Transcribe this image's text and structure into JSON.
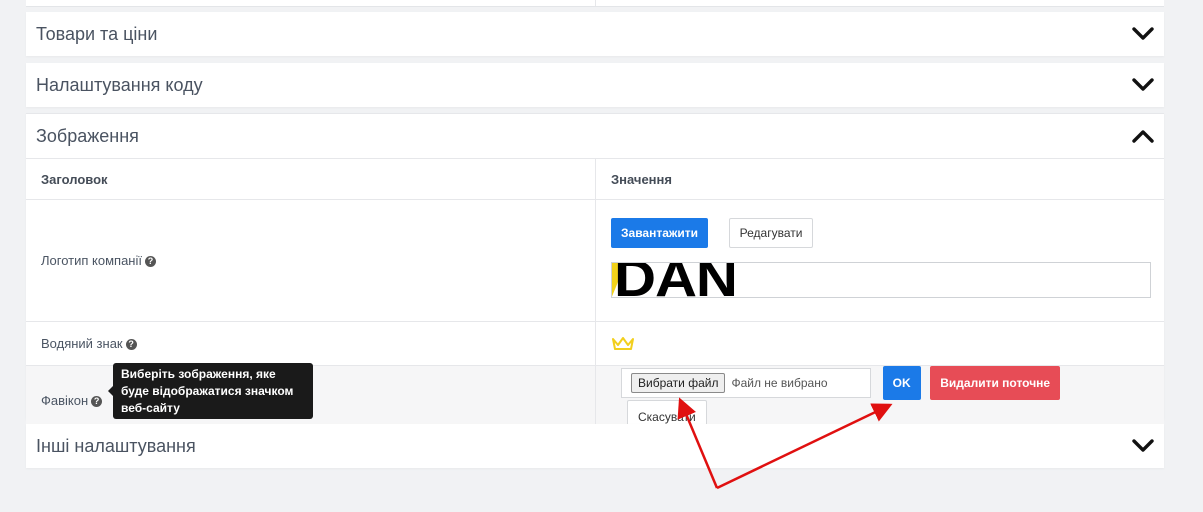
{
  "panels": {
    "goods": {
      "title": "Товари та ціни"
    },
    "code": {
      "title": "Налаштування коду"
    },
    "images": {
      "title": "Зображення"
    },
    "other": {
      "title": "Інші налаштування"
    }
  },
  "table": {
    "headers": {
      "title": "Заголовок",
      "value": "Значення"
    },
    "rows": {
      "logo": {
        "label": "Логотип компанії",
        "upload_label": "Завантажити",
        "edit_label": "Редагувати",
        "logo_text": "DAN"
      },
      "watermark": {
        "label": "Водяний знак"
      },
      "favicon": {
        "label": "Фавікон",
        "choose_file_label": "Вибрати файл",
        "file_status": "Файл не вибрано",
        "ok_label": "OK",
        "delete_label": "Видалити поточне",
        "cancel_label": "Скасувати"
      }
    }
  },
  "tooltip": {
    "text": "Виберіть зображення, яке буде відображатися значком веб-сайту"
  },
  "colors": {
    "primary": "#1b7ae8",
    "danger": "#e74c56",
    "crown": "#f2cf1d",
    "annotation": "#e01010"
  }
}
